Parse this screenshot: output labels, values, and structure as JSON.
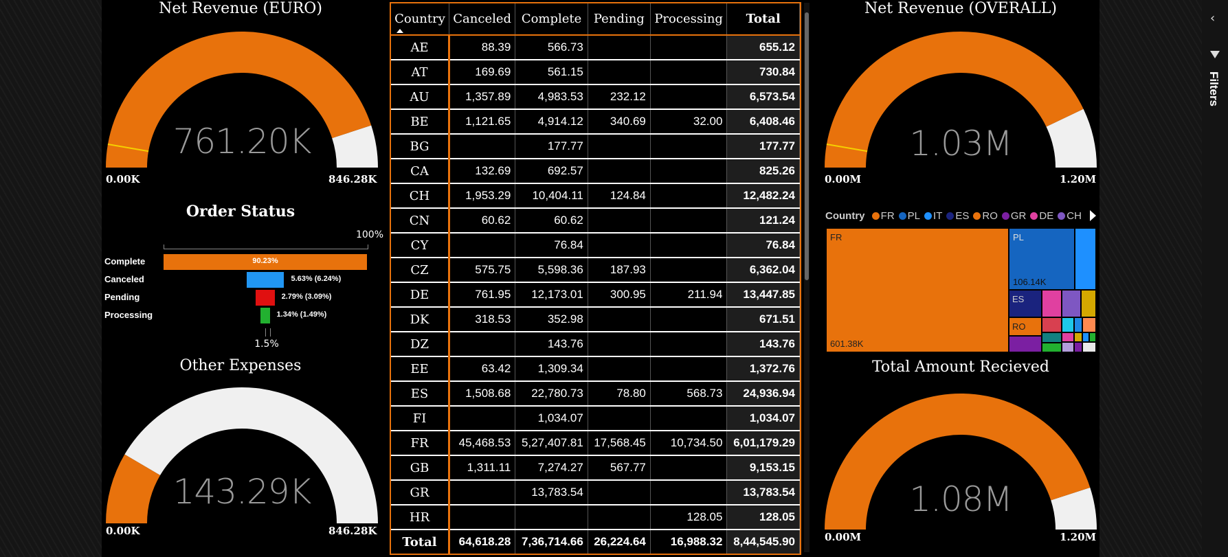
{
  "gauges": {
    "net_revenue_euro": {
      "title": "Net Revenue (EURO)",
      "value": "761.20K",
      "min": "0.00K",
      "max": "846.28K",
      "fraction": 0.8995,
      "target_fraction": 0.055
    },
    "net_revenue_overall": {
      "title": "Net Revenue (OVERALL)",
      "value": "1.03M",
      "min": "0.00M",
      "max": "1.20M",
      "fraction": 0.858,
      "target_fraction": 0.055
    },
    "other_expenses": {
      "title": "Other Expenses",
      "value": "143.29K",
      "min": "0.00K",
      "max": "846.28K",
      "fraction": 0.1693
    },
    "total_amount_received": {
      "title": "Total Amount Recieved",
      "value": "1.08M",
      "min": "0.00M",
      "max": "1.20M",
      "fraction": 0.9
    }
  },
  "order_status": {
    "title": "Order Status",
    "top_label": "100%",
    "bottom_label": "1.5%",
    "rows": [
      {
        "label": "Complete",
        "value_text": "90.23%",
        "pct": 90.23,
        "color": "#e8720c"
      },
      {
        "label": "Canceled",
        "value_text": "5.63% (6.24%)",
        "pct": 5.63,
        "color": "#2196f3"
      },
      {
        "label": "Pending",
        "value_text": "2.79% (3.09%)",
        "pct": 2.79,
        "color": "#e01010"
      },
      {
        "label": "Processing",
        "value_text": "1.34% (1.49%)",
        "pct": 1.34,
        "color": "#22b030"
      }
    ]
  },
  "table": {
    "headers": [
      "Country",
      "Canceled",
      "Complete",
      "Pending",
      "Processing",
      "Total"
    ],
    "rows": [
      [
        "AE",
        "88.39",
        "566.73",
        "",
        "",
        "655.12"
      ],
      [
        "AT",
        "169.69",
        "561.15",
        "",
        "",
        "730.84"
      ],
      [
        "AU",
        "1,357.89",
        "4,983.53",
        "232.12",
        "",
        "6,573.54"
      ],
      [
        "BE",
        "1,121.65",
        "4,914.12",
        "340.69",
        "32.00",
        "6,408.46"
      ],
      [
        "BG",
        "",
        "177.77",
        "",
        "",
        "177.77"
      ],
      [
        "CA",
        "132.69",
        "692.57",
        "",
        "",
        "825.26"
      ],
      [
        "CH",
        "1,953.29",
        "10,404.11",
        "124.84",
        "",
        "12,482.24"
      ],
      [
        "CN",
        "60.62",
        "60.62",
        "",
        "",
        "121.24"
      ],
      [
        "CY",
        "",
        "76.84",
        "",
        "",
        "76.84"
      ],
      [
        "CZ",
        "575.75",
        "5,598.36",
        "187.93",
        "",
        "6,362.04"
      ],
      [
        "DE",
        "761.95",
        "12,173.01",
        "300.95",
        "211.94",
        "13,447.85"
      ],
      [
        "DK",
        "318.53",
        "352.98",
        "",
        "",
        "671.51"
      ],
      [
        "DZ",
        "",
        "143.76",
        "",
        "",
        "143.76"
      ],
      [
        "EE",
        "63.42",
        "1,309.34",
        "",
        "",
        "1,372.76"
      ],
      [
        "ES",
        "1,508.68",
        "22,780.73",
        "78.80",
        "568.73",
        "24,936.94"
      ],
      [
        "FI",
        "",
        "1,034.07",
        "",
        "",
        "1,034.07"
      ],
      [
        "FR",
        "45,468.53",
        "5,27,407.81",
        "17,568.45",
        "10,734.50",
        "6,01,179.29"
      ],
      [
        "GB",
        "1,311.11",
        "7,274.27",
        "567.77",
        "",
        "9,153.15"
      ],
      [
        "GR",
        "",
        "13,783.54",
        "",
        "",
        "13,783.54"
      ],
      [
        "HR",
        "",
        "",
        "",
        "128.05",
        "128.05"
      ]
    ],
    "total_row": [
      "Total",
      "64,618.28",
      "7,36,714.66",
      "26,224.64",
      "16,988.32",
      "8,44,545.90"
    ]
  },
  "treemap": {
    "legend_title": "Country",
    "legend": [
      {
        "name": "FR",
        "color": "#e8720c"
      },
      {
        "name": "PL",
        "color": "#1565c0"
      },
      {
        "name": "IT",
        "color": "#1e90ff"
      },
      {
        "name": "ES",
        "color": "#1a237e"
      },
      {
        "name": "RO",
        "color": "#e8720c"
      },
      {
        "name": "GR",
        "color": "#7b1fa2"
      },
      {
        "name": "DE",
        "color": "#e040a0"
      },
      {
        "name": "CH",
        "color": "#7e57c2"
      }
    ],
    "labels": {
      "fr": "FR",
      "fr_value": "601.38K",
      "pl": "PL",
      "pl_value": "106.14K",
      "es": "ES",
      "ro": "RO"
    }
  },
  "side_panel": {
    "filters_label": "Filters"
  }
}
